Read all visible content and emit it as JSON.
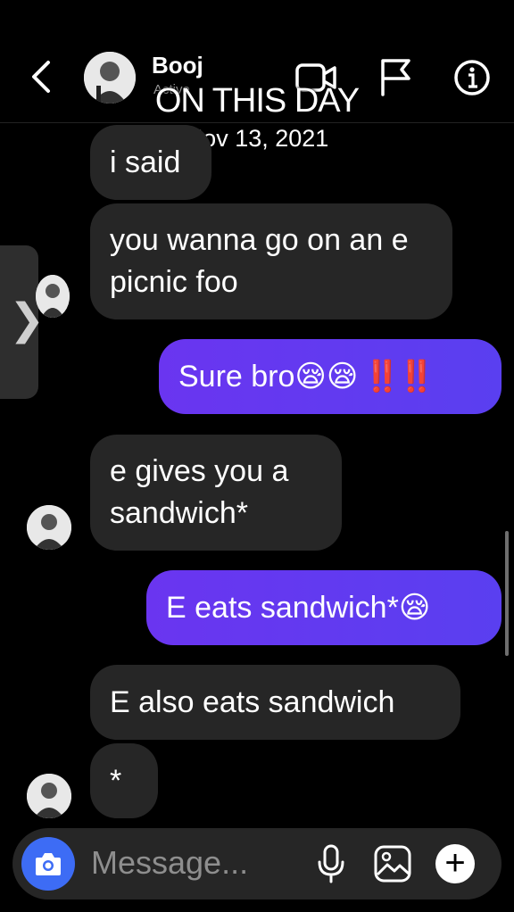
{
  "header": {
    "contact_name": "Booj",
    "status": "Active"
  },
  "overlay": {
    "title": "ON THIS DAY",
    "date": "Nov 13, 2021"
  },
  "messages": [
    {
      "direction": "in",
      "text": "i said"
    },
    {
      "direction": "in",
      "text": "you wanna go on an e picnic foo"
    },
    {
      "direction": "out",
      "text": "Sure bro",
      "emoji": "😪😪",
      "exclaim": "‼️‼️"
    },
    {
      "direction": "in",
      "text": "e gives you a sandwich*"
    },
    {
      "direction": "out",
      "text": "E eats sandwich*",
      "emoji": "😪"
    },
    {
      "direction": "in",
      "text": "E also eats sandwich"
    },
    {
      "direction": "in",
      "text": "*"
    }
  ],
  "side_tab": {
    "glyph": "❯"
  },
  "composer": {
    "placeholder": "Message...",
    "icons": [
      "camera-icon",
      "microphone-icon",
      "gallery-icon",
      "plus-icon"
    ]
  },
  "colors": {
    "background": "#000000",
    "incoming_bubble": "#262626",
    "outgoing_bubble": "#6a35f0",
    "camera_button": "#3d6cf5"
  }
}
